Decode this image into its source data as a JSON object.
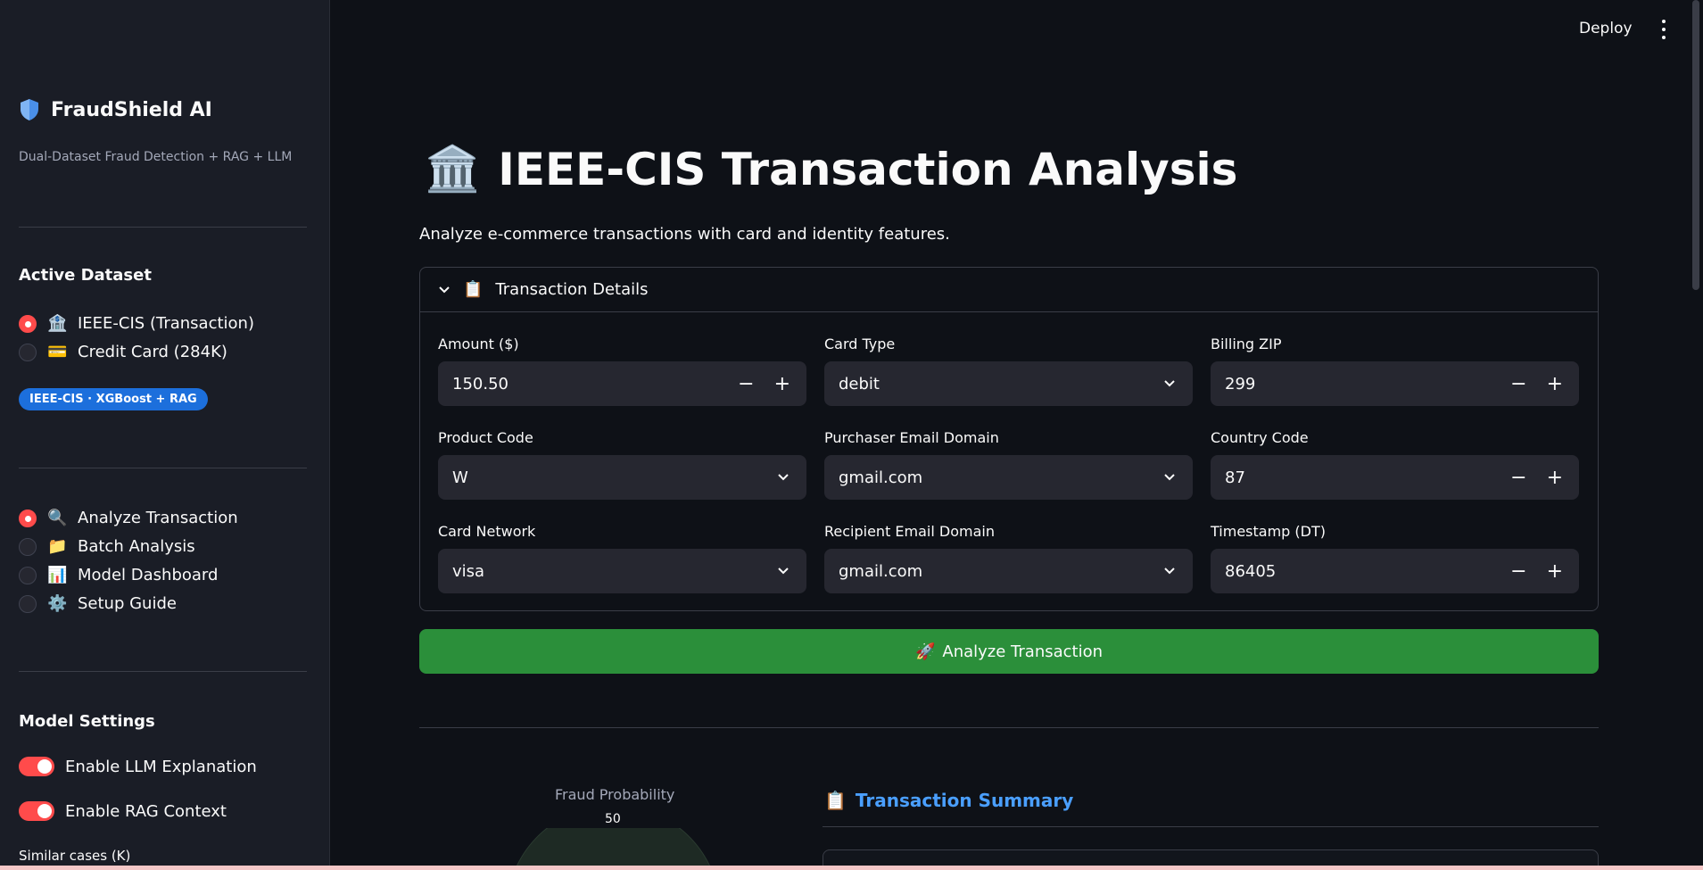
{
  "sidebar": {
    "brand": "FraudShield AI",
    "tagline": "Dual-Dataset Fraud Detection + RAG + LLM",
    "active_dataset_title": "Active Dataset",
    "datasets": [
      {
        "icon": "🏦",
        "label": "IEEE-CIS (Transaction)",
        "selected": true
      },
      {
        "icon": "💳",
        "label": "Credit Card (284K)",
        "selected": false
      }
    ],
    "badge": "IEEE-CIS · XGBoost + RAG",
    "nav": [
      {
        "icon": "🔍",
        "label": "Analyze Transaction",
        "selected": true
      },
      {
        "icon": "📁",
        "label": "Batch Analysis",
        "selected": false
      },
      {
        "icon": "📊",
        "label": "Model Dashboard",
        "selected": false
      },
      {
        "icon": "⚙️",
        "label": "Setup Guide",
        "selected": false
      }
    ],
    "model_settings_title": "Model Settings",
    "toggles": [
      {
        "label": "Enable LLM Explanation",
        "on": true
      },
      {
        "label": "Enable RAG Context",
        "on": true
      }
    ],
    "similar_cases_label": "Similar cases (K)"
  },
  "topbar": {
    "deploy_label": "Deploy"
  },
  "main": {
    "title_icon": "🏛️",
    "title": "IEEE-CIS Transaction Analysis",
    "subtitle": "Analyze e-commerce transactions with card and identity features.",
    "expander": {
      "icon": "📋",
      "label": "Transaction Details",
      "fields": {
        "amount": {
          "label": "Amount ($)",
          "value": "150.50"
        },
        "card_type": {
          "label": "Card Type",
          "value": "debit"
        },
        "billing_zip": {
          "label": "Billing ZIP",
          "value": "299"
        },
        "product_code": {
          "label": "Product Code",
          "value": "W"
        },
        "purchaser_email": {
          "label": "Purchaser Email Domain",
          "value": "gmail.com"
        },
        "country_code": {
          "label": "Country Code",
          "value": "87"
        },
        "card_network": {
          "label": "Card Network",
          "value": "visa"
        },
        "recipient_email": {
          "label": "Recipient Email Domain",
          "value": "gmail.com"
        },
        "timestamp": {
          "label": "Timestamp (DT)",
          "value": "86405"
        }
      }
    },
    "analyze_button": {
      "icon": "🚀",
      "label": "Analyze Transaction"
    },
    "gauge": {
      "title": "Fraud Probability",
      "tick": "50"
    },
    "summary": {
      "icon": "📋",
      "title": "Transaction Summary"
    }
  },
  "colors": {
    "accent": "#ff4b4b",
    "button": "#2b8f3a",
    "link": "#4a9fff",
    "badge": "#1c6fdc"
  }
}
